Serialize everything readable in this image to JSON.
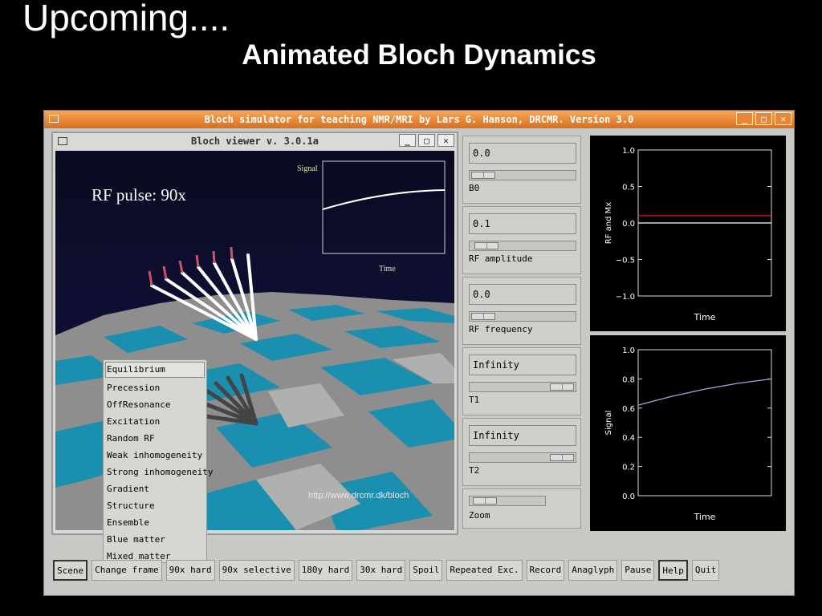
{
  "slide": {
    "title": "Upcoming....",
    "subtitle": "Animated Bloch Dynamics"
  },
  "main_window": {
    "title": "Bloch simulator for teaching NMR/MRI by Lars G. Hanson, DRCMR. Version 3.0",
    "buttons": [
      "_",
      "□",
      "✕"
    ]
  },
  "viewer": {
    "title": "Bloch viewer v. 3.0.1a",
    "buttons": [
      "_",
      "□",
      "✕"
    ],
    "overlay_text": "RF pulse: 90x",
    "inset_signal_label": "Signal",
    "inset_time_label": "Time",
    "url": "http://www.drcmr.dk/bloch"
  },
  "scene_menu": {
    "items": [
      "Equilibrium",
      "Precession",
      "OffResonance",
      "Excitation",
      "Random RF",
      "Weak inhomogeneity",
      "Strong inhomogeneity",
      "Gradient",
      "Structure",
      "Ensemble",
      "Blue matter",
      "Mixed matter"
    ],
    "selected": "Equilibrium"
  },
  "controls": [
    {
      "label": "B0",
      "value": "0.0"
    },
    {
      "label": "RF amplitude",
      "value": "0.1"
    },
    {
      "label": "RF frequency",
      "value": "0.0"
    },
    {
      "label": "T1",
      "value": "Infinity"
    },
    {
      "label": "T2",
      "value": "Infinity"
    },
    {
      "label": "Zoom"
    }
  ],
  "chart_data": [
    {
      "type": "line",
      "xlabel": "Time",
      "ylabel": "RF and Mx",
      "ylim": [
        -1.0,
        1.0
      ],
      "yticks": [
        "1.0",
        "0.5",
        "0.0",
        "−0.5",
        "−1.0"
      ],
      "series": [
        {
          "color": "#cc2222",
          "x": [
            0,
            1
          ],
          "y": [
            0.1,
            0.1
          ]
        },
        {
          "color": "#ffffff",
          "x": [
            0,
            1
          ],
          "y": [
            0.0,
            0.0
          ]
        }
      ]
    },
    {
      "type": "line",
      "xlabel": "Time",
      "ylabel": "Signal",
      "ylim": [
        0.0,
        1.0
      ],
      "yticks": [
        "1.0",
        "0.8",
        "0.6",
        "0.4",
        "0.2",
        "0.0"
      ],
      "series": [
        {
          "color": "#b39ddb",
          "x": [
            0,
            0.25,
            0.5,
            0.75,
            1.0
          ],
          "y": [
            0.62,
            0.68,
            0.73,
            0.77,
            0.8
          ]
        }
      ]
    }
  ],
  "toolbar": [
    "Scene",
    "Change frame",
    "90x hard",
    "90x selective",
    "180y hard",
    "30x hard",
    "Spoil",
    "Repeated Exc.",
    "Record",
    "Anaglyph",
    "Pause",
    "Help",
    "Quit"
  ]
}
